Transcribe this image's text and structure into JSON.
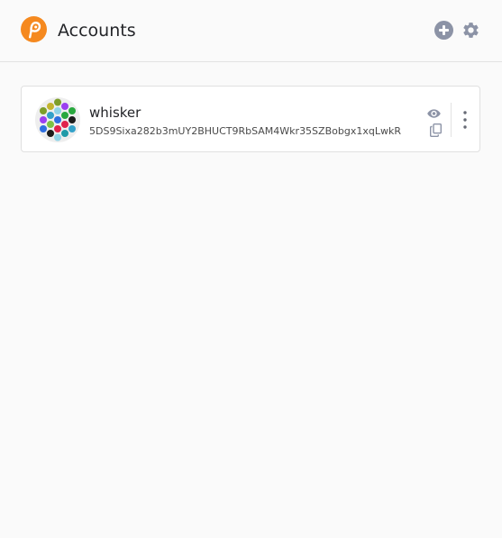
{
  "header": {
    "title": "Accounts",
    "logo_icon": "polkadot-logo-icon",
    "add_icon": "plus-circle-icon",
    "settings_icon": "gear-icon"
  },
  "accounts": [
    {
      "name": "whisker",
      "address": "5DS9Sixa282b3mUY2BHUCT9RbSAM4Wkr35SZBobgx1xqLwkR",
      "avatar_icon": "identicon-icon",
      "show_icon": "eye-icon",
      "copy_icon": "copy-icon",
      "menu_icon": "more-vertical-icon"
    }
  ],
  "colors": {
    "brand": "#f5891f",
    "icon_gray": "#8c93a6",
    "background": "#fafafa",
    "card": "#ffffff",
    "border": "#e2e2e2"
  }
}
